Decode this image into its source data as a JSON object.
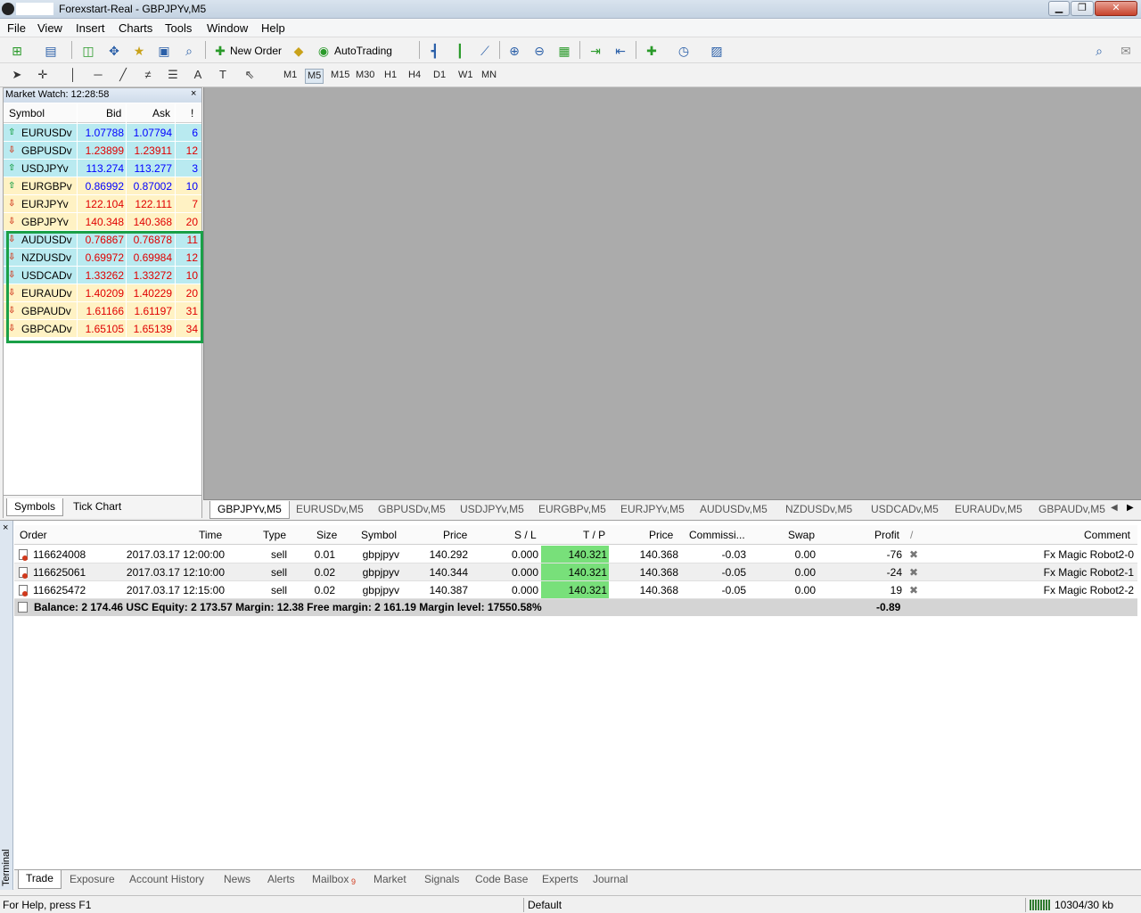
{
  "window": {
    "title": "Forexstart-Real - GBPJPYv,M5"
  },
  "menu": [
    "File",
    "View",
    "Insert",
    "Charts",
    "Tools",
    "Window",
    "Help"
  ],
  "toolbar": {
    "new_order": "New Order",
    "autotrading": "AutoTrading"
  },
  "timeframes": [
    "M1",
    "M5",
    "M15",
    "M30",
    "H1",
    "H4",
    "D1",
    "W1",
    "MN"
  ],
  "active_timeframe": "M5",
  "draw_tools": {
    "text": "A",
    "text_label": "T"
  },
  "market_watch": {
    "title": "Market Watch: 12:28:58",
    "close": "×",
    "headers": {
      "symbol": "Symbol",
      "bid": "Bid",
      "ask": "Ask",
      "spread": "!"
    },
    "rows": [
      {
        "symbol": "EURUSDv",
        "bid": "1.07788",
        "ask": "1.07794",
        "spread": "6",
        "dir": "up"
      },
      {
        "symbol": "GBPUSDv",
        "bid": "1.23899",
        "ask": "1.23911",
        "spread": "12",
        "dir": "down"
      },
      {
        "symbol": "USDJPYv",
        "bid": "113.274",
        "ask": "113.277",
        "spread": "3",
        "dir": "up"
      },
      {
        "symbol": "EURGBPv",
        "bid": "0.86992",
        "ask": "0.87002",
        "spread": "10",
        "dir": "up"
      },
      {
        "symbol": "EURJPYv",
        "bid": "122.104",
        "ask": "122.111",
        "spread": "7",
        "dir": "down"
      },
      {
        "symbol": "GBPJPYv",
        "bid": "140.348",
        "ask": "140.368",
        "spread": "20",
        "dir": "down"
      },
      {
        "symbol": "AUDUSDv",
        "bid": "0.76867",
        "ask": "0.76878",
        "spread": "11",
        "dir": "down"
      },
      {
        "symbol": "NZDUSDv",
        "bid": "0.69972",
        "ask": "0.69984",
        "spread": "12",
        "dir": "down"
      },
      {
        "symbol": "USDCADv",
        "bid": "1.33262",
        "ask": "1.33272",
        "spread": "10",
        "dir": "down"
      },
      {
        "symbol": "EURAUDv",
        "bid": "1.40209",
        "ask": "1.40229",
        "spread": "20",
        "dir": "down"
      },
      {
        "symbol": "GBPAUDv",
        "bid": "1.61166",
        "ask": "1.61197",
        "spread": "31",
        "dir": "down"
      },
      {
        "symbol": "GBPCADv",
        "bid": "1.65105",
        "ask": "1.65139",
        "spread": "34",
        "dir": "down"
      }
    ],
    "tabs": [
      "Symbols",
      "Tick Chart"
    ]
  },
  "chart_tabs": [
    "GBPJPYv,M5",
    "EURUSDv,M5",
    "GBPUSDv,M5",
    "USDJPYv,M5",
    "EURGBPv,M5",
    "EURJPYv,M5",
    "AUDUSDv,M5",
    "NZDUSDv,M5",
    "USDCADv,M5",
    "EURAUDv,M5",
    "GBPAUDv,M5"
  ],
  "terminal": {
    "side_label": "Terminal",
    "close": "×",
    "headers": {
      "order": "Order",
      "time": "Time",
      "type": "Type",
      "size": "Size",
      "symbol": "Symbol",
      "price": "Price",
      "sl": "S / L",
      "tp": "T / P",
      "price2": "Price",
      "commission": "Commissi...",
      "swap": "Swap",
      "profit": "Profit",
      "sort": "/",
      "comment": "Comment"
    },
    "rows": [
      {
        "order": "116624008",
        "time": "2017.03.17 12:00:00",
        "type": "sell",
        "size": "0.01",
        "symbol": "gbpjpyv",
        "price": "140.292",
        "sl": "0.000",
        "tp": "140.321",
        "price2": "140.368",
        "commission": "-0.03",
        "swap": "0.00",
        "profit": "-76",
        "comment": "Fx Magic Robot2-0"
      },
      {
        "order": "116625061",
        "time": "2017.03.17 12:10:00",
        "type": "sell",
        "size": "0.02",
        "symbol": "gbpjpyv",
        "price": "140.344",
        "sl": "0.000",
        "tp": "140.321",
        "price2": "140.368",
        "commission": "-0.05",
        "swap": "0.00",
        "profit": "-24",
        "comment": "Fx Magic Robot2-1"
      },
      {
        "order": "116625472",
        "time": "2017.03.17 12:15:00",
        "type": "sell",
        "size": "0.02",
        "symbol": "gbpjpyv",
        "price": "140.387",
        "sl": "0.000",
        "tp": "140.321",
        "price2": "140.368",
        "commission": "-0.05",
        "swap": "0.00",
        "profit": "19",
        "comment": "Fx Magic Robot2-2"
      }
    ],
    "balance_line": "Balance: 2 174.46 USC  Equity: 2 173.57  Margin: 12.38  Free margin: 2 161.19  Margin level: 17550.58%",
    "total_profit": "-0.89",
    "tabs": [
      "Trade",
      "Exposure",
      "Account History",
      "News",
      "Alerts",
      "Mailbox",
      "Market",
      "Signals",
      "Code Base",
      "Experts",
      "Journal"
    ],
    "mailbox_count": "9"
  },
  "status": {
    "help": "For Help, press F1",
    "profile": "Default",
    "traffic": "10304/30 kb"
  },
  "colors": {
    "up": "#1aa047",
    "down": "#d0391c",
    "bid_up": "#0000ff",
    "bid_down": "#e00000",
    "highlight": "#1aa047",
    "tp_fill": "#78e07a"
  }
}
